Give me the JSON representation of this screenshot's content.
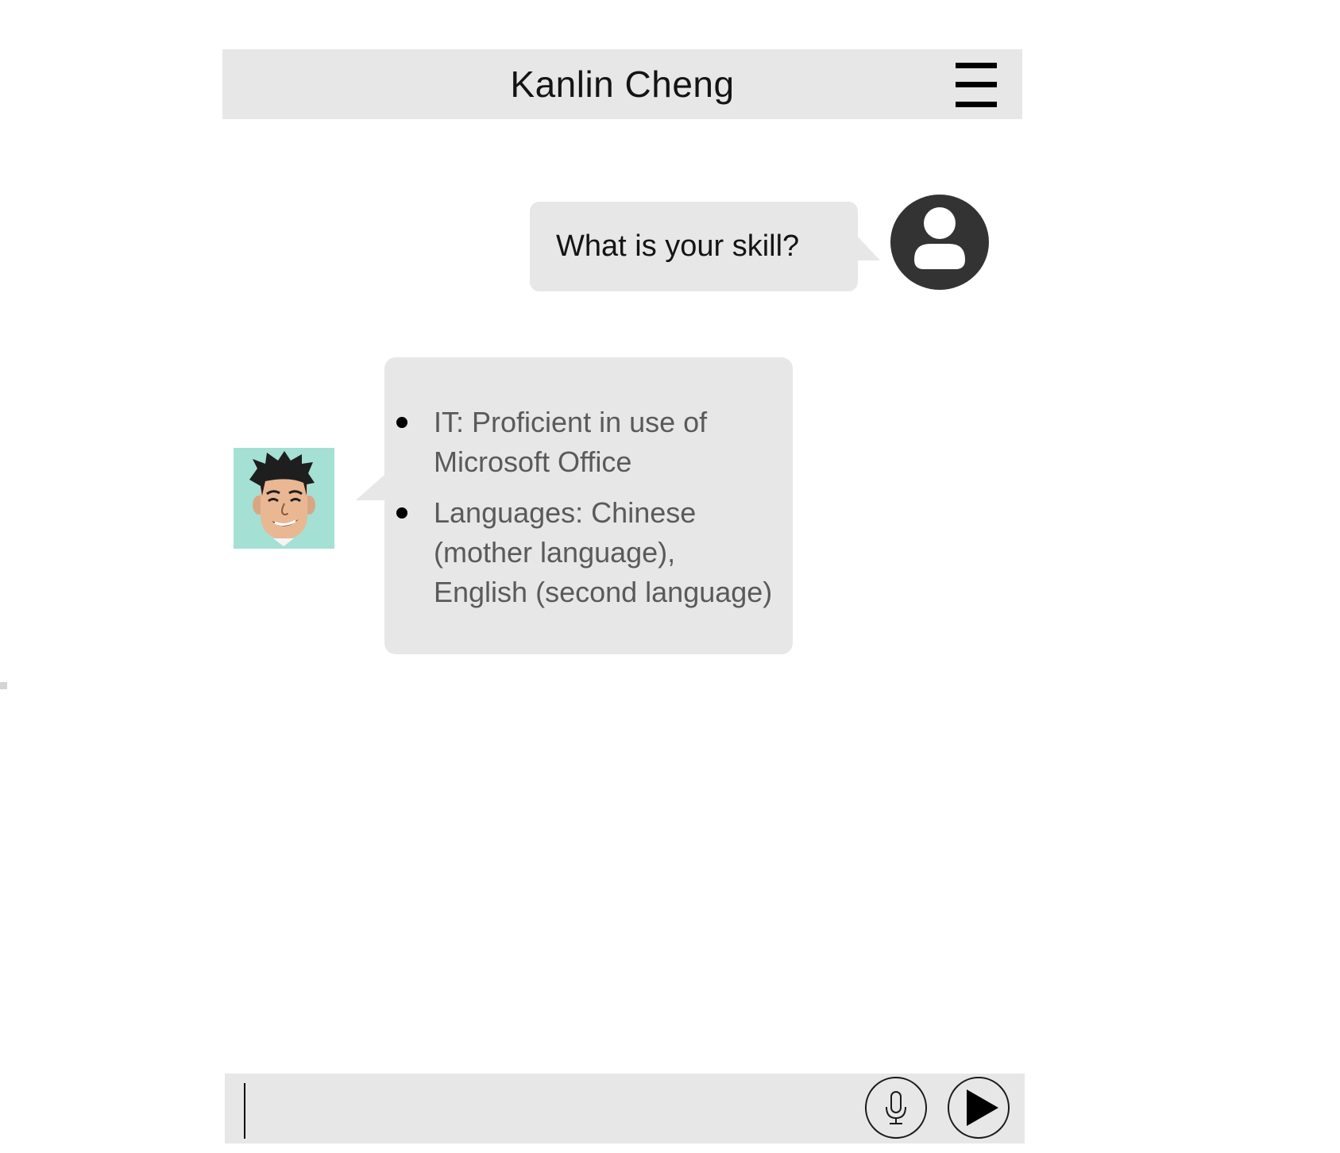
{
  "header": {
    "title": "Kanlin Cheng",
    "menu_icon": "hamburger-menu-icon"
  },
  "conversation": {
    "user_message": {
      "text": "What is your skill?",
      "avatar_icon": "user-silhouette-icon"
    },
    "bot_message": {
      "avatar_icon": "cartoon-man-avatar",
      "items": [
        {
          "lines": [
            "IT: Proficient in use of",
            "Microsoft Office"
          ]
        },
        {
          "lines": [
            "Languages: Chinese",
            "(mother language),",
            "English (second language)"
          ]
        }
      ]
    }
  },
  "composer": {
    "input_value": "",
    "mic_icon": "microphone-icon",
    "send_icon": "play-send-icon"
  },
  "colors": {
    "panel_gray": "#e7e7e7",
    "user_avatar": "#333333",
    "bot_avatar_bg": "#a4e0d4",
    "bot_text": "#5a5a5a"
  }
}
